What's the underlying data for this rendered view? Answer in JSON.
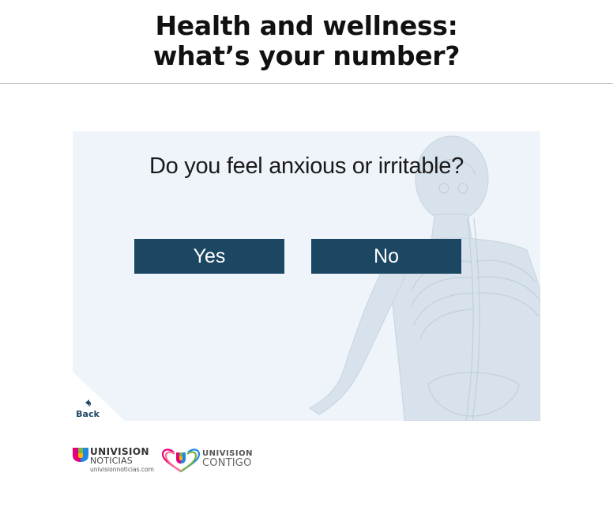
{
  "header": {
    "title_line1": "Health and wellness:",
    "title_line2": "what’s your number?"
  },
  "quiz": {
    "question": "Do you feel anxious or irritable?",
    "answers": [
      {
        "label": "Yes"
      },
      {
        "label": "No"
      }
    ],
    "back_label": "Back"
  },
  "footer": {
    "logos": [
      {
        "name": "univision-noticias-logo",
        "line1": "UNIVISION",
        "line2": "NOTICIAS",
        "line3": "univisionnoticias.com"
      },
      {
        "name": "univision-contigo-logo",
        "line1": "UNIVISION",
        "line2": "CONTIGO"
      }
    ]
  },
  "colors": {
    "button_bg": "#1b4763",
    "panel_bg": "#eef4fa",
    "header_rule": "#c8c8c8"
  },
  "icons": {
    "back": "back-arrow-icon",
    "illustration": "human-anatomy-illustration"
  }
}
